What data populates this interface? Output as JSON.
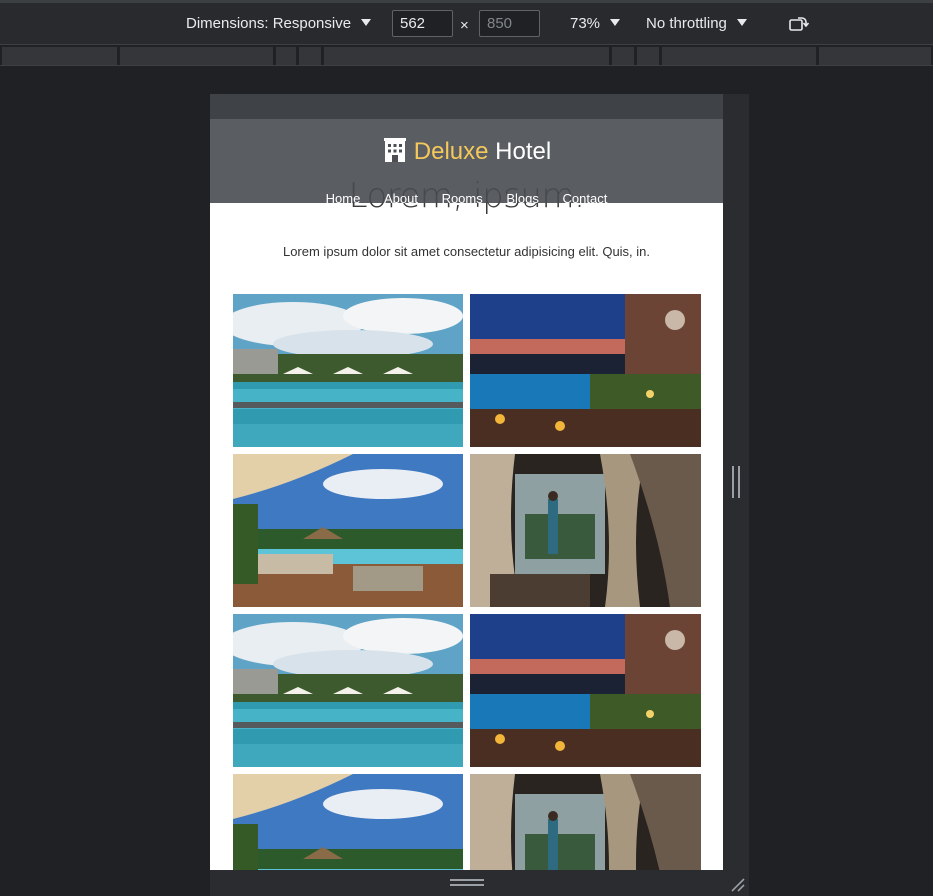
{
  "devtools": {
    "dimensions_label": "Dimensions: Responsive",
    "width_value": "562",
    "height_placeholder": "850",
    "times": "×",
    "zoom": "73%",
    "throttling": "No throttling",
    "icons": {
      "dropdown": "triangle-down-icon",
      "rotate": "rotate-device-icon"
    }
  },
  "site": {
    "brand_icon": "hotel-building-icon",
    "brand_accent": "Deluxe",
    "brand_rest": "Hotel",
    "nav": [
      "Home",
      "About",
      "Rooms",
      "Blogs",
      "Contact"
    ],
    "hero_title": "Lorem, ipsum.",
    "hero_text": "Lorem ipsum dolor sit amet consectetur adipisicing elit. Quis, in.",
    "colors": {
      "accent": "#f5c85b",
      "header_bg": "#4b4e52"
    }
  },
  "gallery": [
    "pool-daytime",
    "pool-sunset-terrace",
    "beach-pool-loungers",
    "canopy-bedroom",
    "pool-daytime",
    "pool-sunset-terrace",
    "beach-pool-loungers",
    "canopy-bedroom"
  ]
}
